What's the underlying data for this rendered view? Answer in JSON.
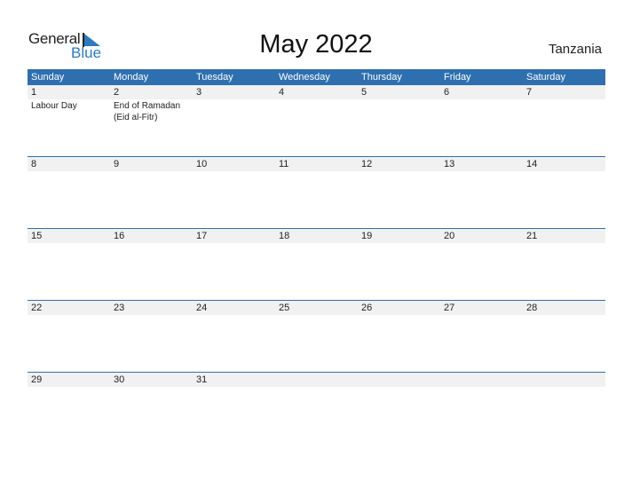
{
  "logo": {
    "text1": "General",
    "text2": "Blue"
  },
  "title": "May 2022",
  "country": "Tanzania",
  "colors": {
    "header_bg": "#2e6fb0",
    "date_strip_bg": "#f1f1f1",
    "logo_blue": "#2a7bc4"
  },
  "weekdays": [
    "Sunday",
    "Monday",
    "Tuesday",
    "Wednesday",
    "Thursday",
    "Friday",
    "Saturday"
  ],
  "weeks": [
    {
      "days": [
        "1",
        "2",
        "3",
        "4",
        "5",
        "6",
        "7"
      ],
      "events": [
        "Labour Day",
        "End of Ramadan\n(Eid al-Fitr)",
        "",
        "",
        "",
        "",
        ""
      ]
    },
    {
      "days": [
        "8",
        "9",
        "10",
        "11",
        "12",
        "13",
        "14"
      ],
      "events": [
        "",
        "",
        "",
        "",
        "",
        "",
        ""
      ]
    },
    {
      "days": [
        "15",
        "16",
        "17",
        "18",
        "19",
        "20",
        "21"
      ],
      "events": [
        "",
        "",
        "",
        "",
        "",
        "",
        ""
      ]
    },
    {
      "days": [
        "22",
        "23",
        "24",
        "25",
        "26",
        "27",
        "28"
      ],
      "events": [
        "",
        "",
        "",
        "",
        "",
        "",
        ""
      ]
    },
    {
      "days": [
        "29",
        "30",
        "31",
        "",
        "",
        "",
        ""
      ],
      "events": [
        "",
        "",
        "",
        "",
        "",
        "",
        ""
      ]
    }
  ]
}
